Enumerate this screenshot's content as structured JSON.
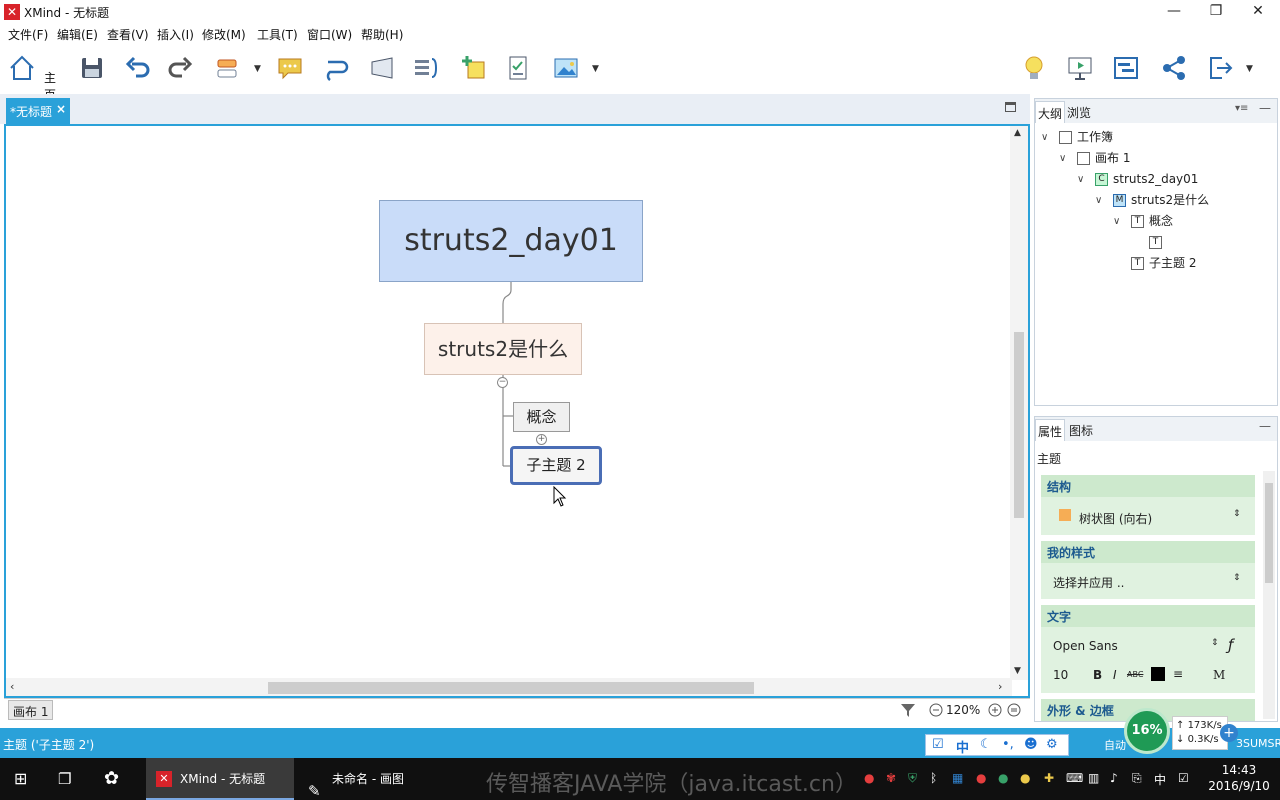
{
  "window": {
    "title": "XMind - 无标题",
    "logo_glyph": "✕",
    "minimize_glyph": "—",
    "maximize_glyph": "❐",
    "close_glyph": "✕"
  },
  "menu": [
    "文件(F)",
    "编辑(E)",
    "查看(V)",
    "插入(I)",
    "修改(M)",
    "工具(T)",
    "窗口(W)",
    "帮助(H)"
  ],
  "toolbar": {
    "home_label": "主页",
    "buttons": [
      "home-icon",
      "save-icon",
      "undo-icon",
      "redo-icon",
      "topic-icon",
      "callout-icon",
      "relationship-icon",
      "boundary-icon",
      "summary-icon",
      "marker-icon",
      "task-icon",
      "image-icon",
      "idea-icon",
      "presentation-icon",
      "gantt-icon",
      "share-icon",
      "export-icon"
    ]
  },
  "editor": {
    "tab_label": "*无标题",
    "tab_close": "×"
  },
  "mindmap": {
    "central": "struts2_day01",
    "main_topic": "struts2是什么",
    "sub_topic_1": "概念",
    "sub_topic_2": "子主题 2",
    "collapse_minus": "−",
    "collapse_plus": "+"
  },
  "canvas_status": {
    "sheet_tab": "画布 1",
    "zoom": "120%"
  },
  "outline": {
    "tabs": [
      "大纲",
      "浏览"
    ],
    "rows": [
      {
        "label": "工作簿",
        "icon": "workbook-icon"
      },
      {
        "label": "画布 1",
        "icon": "sheet-icon"
      },
      {
        "label": "struts2_day01",
        "icon": "central-topic-icon",
        "glyph": "C"
      },
      {
        "label": "struts2是什么",
        "icon": "main-topic-icon",
        "glyph": "M"
      },
      {
        "label": "概念",
        "icon": "topic-icon",
        "glyph": "T"
      },
      {
        "label": "",
        "icon": "topic-icon",
        "glyph": "T"
      },
      {
        "label": "子主题 2",
        "icon": "topic-icon",
        "glyph": "T"
      }
    ]
  },
  "properties": {
    "tabs": [
      "属性",
      "图标"
    ],
    "title": "主题",
    "structure_head": "结构",
    "structure_value": "树状图 (向右)",
    "style_head": "我的样式",
    "style_value": "选择并应用 ..",
    "text_head": "文字",
    "font_name": "Open Sans",
    "font_size": "10",
    "bold": "B",
    "italic": "I",
    "strike": "ABC",
    "align": "≡",
    "case": "M",
    "font_fx": "ƒ",
    "shape_head": "外形 & 边框"
  },
  "app_status": {
    "text": "主题 ('子主题 2')",
    "auto_text": "自动",
    "extra": "3SUMSR"
  },
  "net_widget": {
    "percent": "16%",
    "up": "173K/s",
    "down": "0.3K/s"
  },
  "taskbar": {
    "apps": [
      "XMind - 无标题",
      "未命名 - 画图"
    ],
    "watermark": "传智播客JAVA学院（java.itcast.cn）",
    "time": "14:43",
    "date": "2016/9/10",
    "ime": "中"
  }
}
